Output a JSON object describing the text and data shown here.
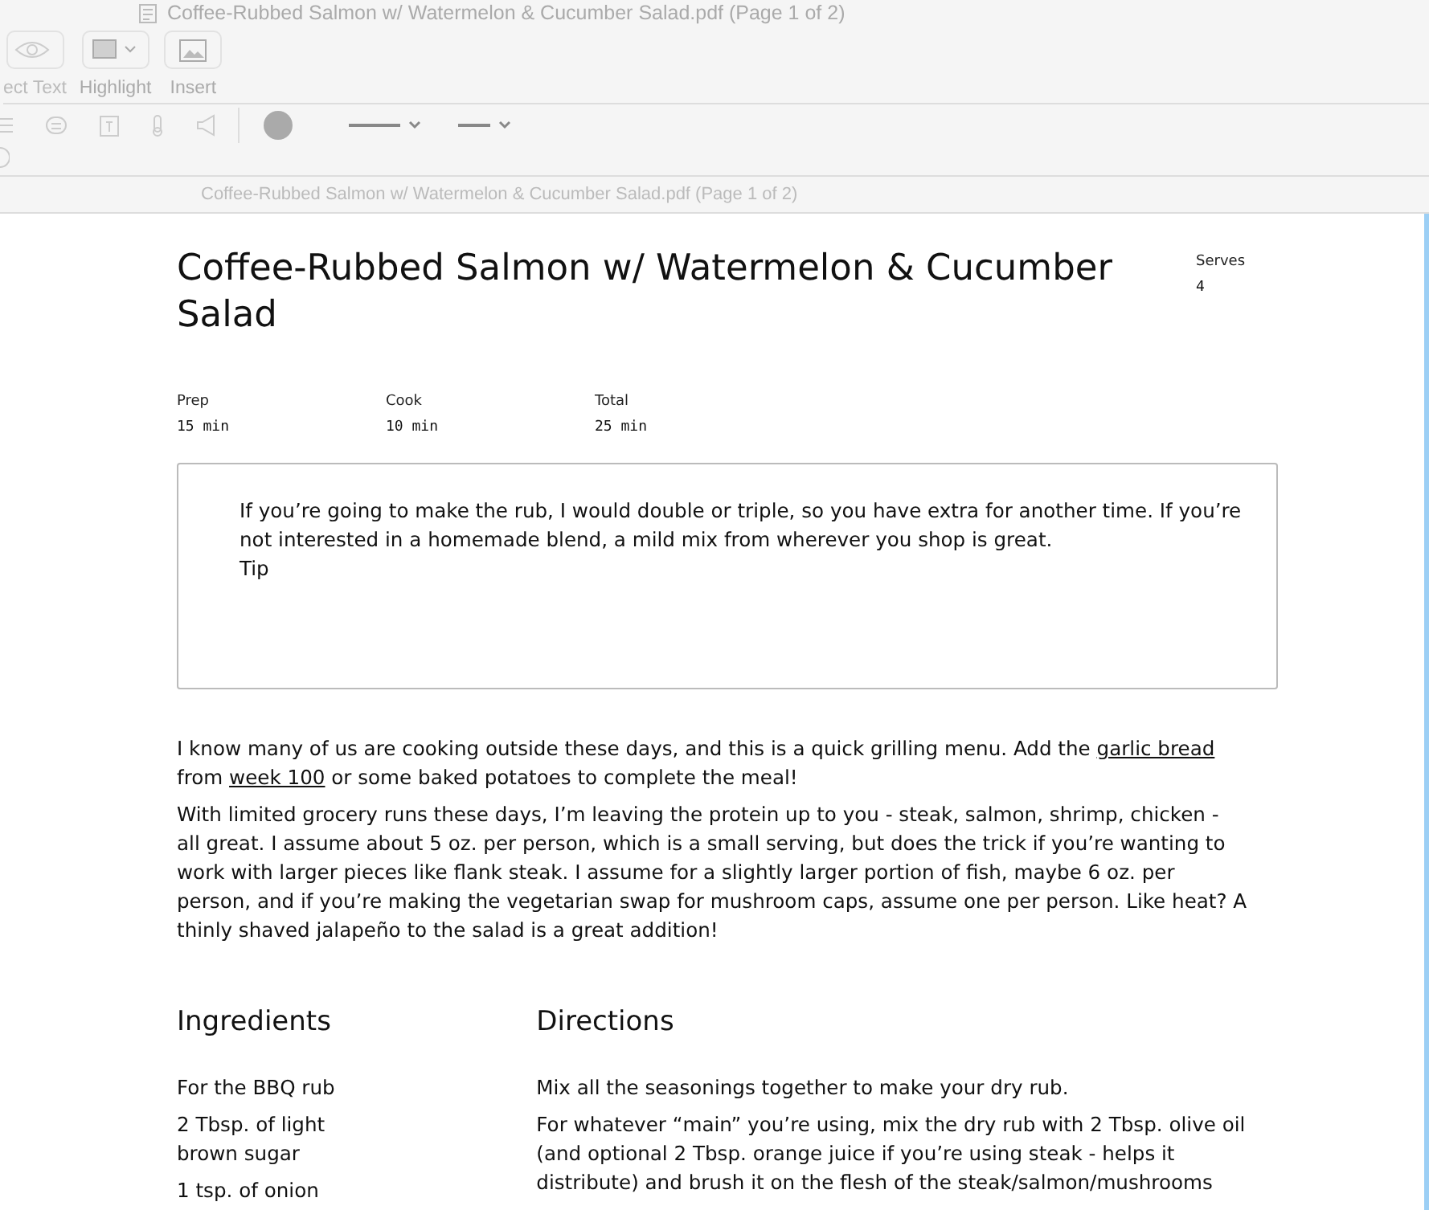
{
  "window": {
    "title": "Coffee-Rubbed Salmon w/ Watermelon & Cucumber Salad.pdf (Page 1 of 2)"
  },
  "toolbar": {
    "buttons": [
      {
        "label": "ect Text"
      },
      {
        "label": "Highlight"
      },
      {
        "label": "Insert"
      }
    ]
  },
  "tab_title": "Coffee-Rubbed Salmon w/ Watermelon & Cucumber Salad.pdf (Page 1 of 2)",
  "document": {
    "title": "Coffee-Rubbed Salmon w/ Watermelon & Cucumber Salad",
    "serves": {
      "label": "Serves",
      "value": "4"
    },
    "times": [
      {
        "label": "Prep",
        "value": "15 min"
      },
      {
        "label": "Cook",
        "value": "10 min"
      },
      {
        "label": "Total",
        "value": "25 min"
      }
    ],
    "tip": {
      "text": "If you’re going to make the rub, I would double or triple, so you have extra for another time. If you’re not interested in a homemade blend, a mild mix from wherever you shop is great.",
      "label": "Tip"
    },
    "intro": [
      [
        {
          "text": "I know many of us are cooking outside these days, and this is a quick grilling menu. Add the ",
          "link": false
        },
        {
          "text": "garlic bread",
          "link": true
        },
        {
          "text": " from ",
          "link": false
        },
        {
          "text": "week 100",
          "link": true
        },
        {
          "text": " or some baked potatoes to complete the meal!",
          "link": false
        }
      ],
      [
        {
          "text": "With limited grocery runs these days, I’m leaving the protein up to you - steak, salmon, shrimp, chicken - all great. I assume about 5 oz. per person, which is a small serving, but does the trick if you’re wanting to work with larger pieces like flank steak. I assume for a slightly larger portion of fish, maybe 6 oz. per person, and if you’re making the vegetarian swap for mushroom caps, assume one per person. Like heat? A thinly shaved jalapeño to the salad is a great addition!",
          "link": false
        }
      ]
    ],
    "ingredients": {
      "heading": "Ingredients",
      "items": [
        "For the BBQ rub",
        "2 Tbsp. of light brown sugar",
        "1 tsp. of onion"
      ]
    },
    "directions": {
      "heading": "Directions",
      "steps": [
        "Mix all the seasonings together to make your dry rub.",
        "For whatever “main” you’re using, mix the dry rub with 2 Tbsp. olive oil (and optional 2 Tbsp. orange juice if you’re using steak - helps it distribute) and brush it on the flesh of the steak/salmon/mushrooms"
      ]
    }
  }
}
